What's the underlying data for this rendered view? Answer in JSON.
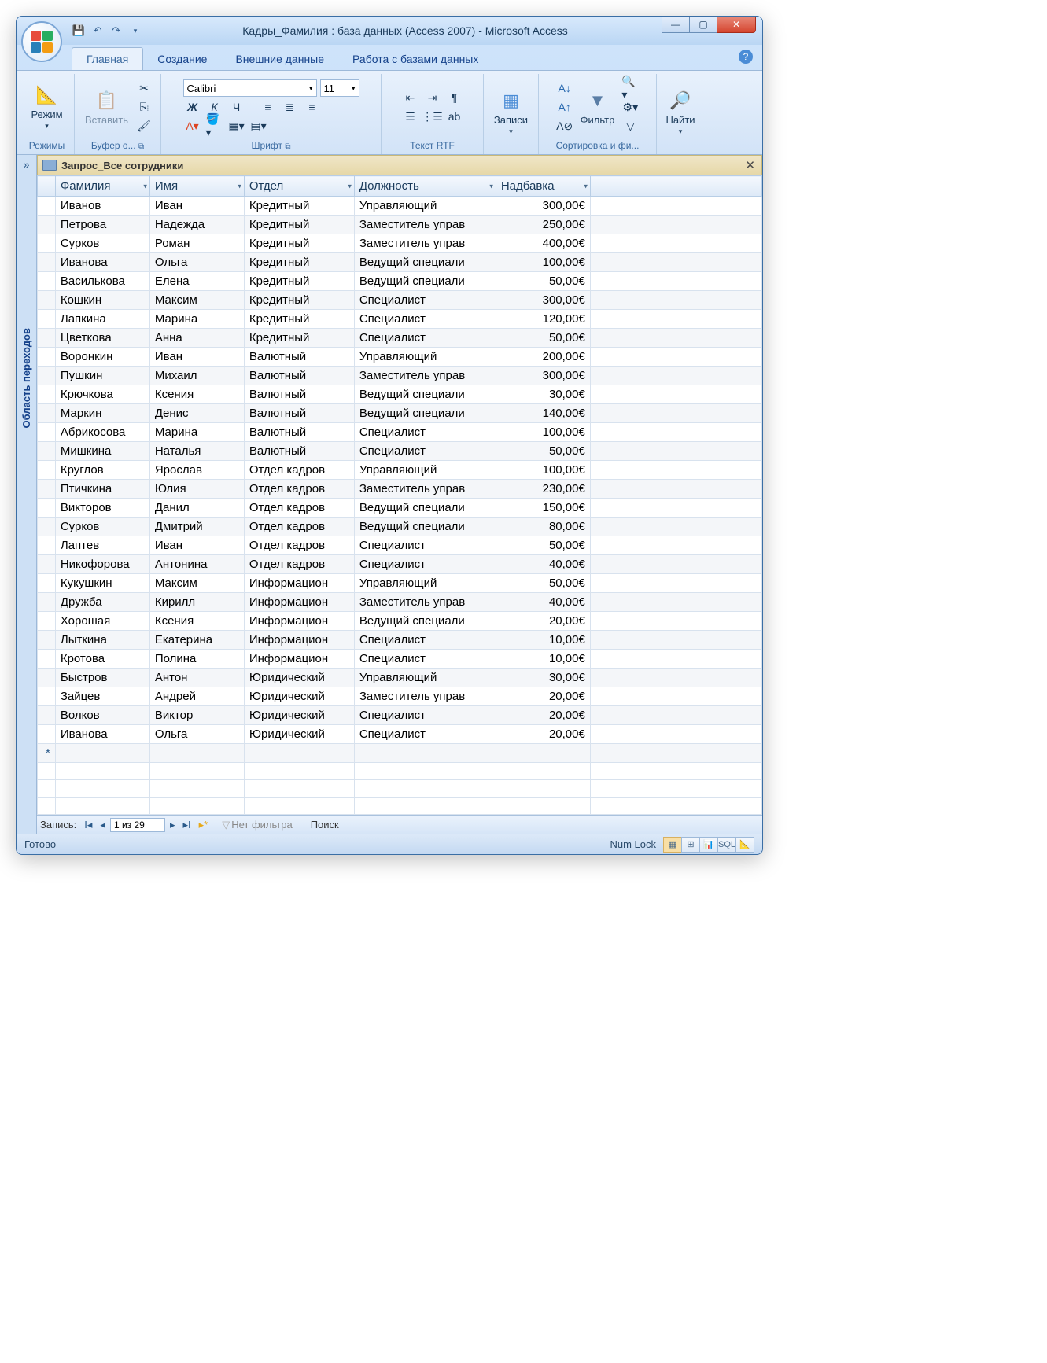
{
  "window": {
    "title": "Кадры_Фамилия : база данных (Access 2007) - Microsoft Access",
    "minimize": "—",
    "maximize": "▢",
    "close": "✕"
  },
  "tabs": {
    "home": "Главная",
    "create": "Создание",
    "external": "Внешние данные",
    "dbtools": "Работа с базами данных"
  },
  "ribbon": {
    "views_group": "Режимы",
    "view": "Режим",
    "clipboard_group": "Буфер о...",
    "paste": "Вставить",
    "font_group": "Шрифт",
    "font_name": "Calibri",
    "font_size": "11",
    "rtf_group": "Текст RTF",
    "records_group": "Записи",
    "records": "Записи",
    "sort_group": "Сортировка и фи...",
    "filter": "Фильтр",
    "find_group": "",
    "find": "Найти"
  },
  "nav": {
    "pane_label": "Область переходов",
    "toggle": "»"
  },
  "object_tab": {
    "title": "Запрос_Все сотрудники"
  },
  "grid": {
    "columns": [
      "Фамилия",
      "Имя",
      "Отдел",
      "Должность",
      "Надбавка"
    ],
    "rows": [
      [
        "Иванов",
        "Иван",
        "Кредитный",
        "Управляющий",
        "300,00€"
      ],
      [
        "Петрова",
        "Надежда",
        "Кредитный",
        "Заместитель управ",
        "250,00€"
      ],
      [
        "Сурков",
        "Роман",
        "Кредитный",
        "Заместитель управ",
        "400,00€"
      ],
      [
        "Иванова",
        "Ольга",
        "Кредитный",
        "Ведущий специали",
        "100,00€"
      ],
      [
        "Василькова",
        "Елена",
        "Кредитный",
        "Ведущий специали",
        "50,00€"
      ],
      [
        "Кошкин",
        "Максим",
        "Кредитный",
        "Специалист",
        "300,00€"
      ],
      [
        "Лапкина",
        "Марина",
        "Кредитный",
        "Специалист",
        "120,00€"
      ],
      [
        "Цветкова",
        "Анна",
        "Кредитный",
        "Специалист",
        "50,00€"
      ],
      [
        "Воронкин",
        "Иван",
        "Валютный",
        "Управляющий",
        "200,00€"
      ],
      [
        "Пушкин",
        "Михаил",
        "Валютный",
        "Заместитель управ",
        "300,00€"
      ],
      [
        "Крючкова",
        "Ксения",
        "Валютный",
        "Ведущий специали",
        "30,00€"
      ],
      [
        "Маркин",
        "Денис",
        "Валютный",
        "Ведущий специали",
        "140,00€"
      ],
      [
        "Абрикосова",
        "Марина",
        "Валютный",
        "Специалист",
        "100,00€"
      ],
      [
        "Мишкина",
        "Наталья",
        "Валютный",
        "Специалист",
        "50,00€"
      ],
      [
        "Круглов",
        "Ярослав",
        "Отдел кадров",
        "Управляющий",
        "100,00€"
      ],
      [
        "Птичкина",
        "Юлия",
        "Отдел кадров",
        "Заместитель управ",
        "230,00€"
      ],
      [
        "Викторов",
        "Данил",
        "Отдел кадров",
        "Ведущий специали",
        "150,00€"
      ],
      [
        "Сурков",
        "Дмитрий",
        "Отдел кадров",
        "Ведущий специали",
        "80,00€"
      ],
      [
        "Лаптев",
        "Иван",
        "Отдел кадров",
        "Специалист",
        "50,00€"
      ],
      [
        "Никофорова",
        "Антонина",
        "Отдел кадров",
        "Специалист",
        "40,00€"
      ],
      [
        "Кукушкин",
        "Максим",
        "Информацион",
        "Управляющий",
        "50,00€"
      ],
      [
        "Дружба",
        "Кирилл",
        "Информацион",
        "Заместитель управ",
        "40,00€"
      ],
      [
        "Хорошая",
        "Ксения",
        "Информацион",
        "Ведущий специали",
        "20,00€"
      ],
      [
        "Лыткина",
        "Екатерина",
        "Информацион",
        "Специалист",
        "10,00€"
      ],
      [
        "Кротова",
        "Полина",
        "Информацион",
        "Специалист",
        "10,00€"
      ],
      [
        "Быстров",
        "Антон",
        "Юридический",
        "Управляющий",
        "30,00€"
      ],
      [
        "Зайцев",
        "Андрей",
        "Юридический",
        "Заместитель управ",
        "20,00€"
      ],
      [
        "Волков",
        "Виктор",
        "Юридический",
        "Специалист",
        "20,00€"
      ],
      [
        "Иванова",
        "Ольга",
        "Юридический",
        "Специалист",
        "20,00€"
      ]
    ]
  },
  "recnav": {
    "label": "Запись:",
    "position": "1 из 29",
    "no_filter": "Нет фильтра",
    "search": "Поиск"
  },
  "status": {
    "ready": "Готово",
    "numlock": "Num Lock"
  }
}
